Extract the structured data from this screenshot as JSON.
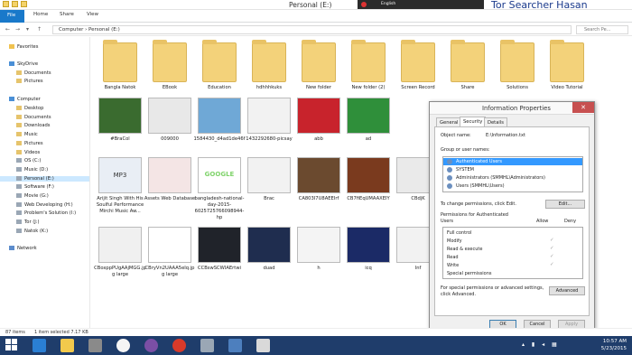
{
  "window": {
    "title": "Personal (E:)",
    "brand_overlay": "Tor Searcher Hasan",
    "recorder_label": "English"
  },
  "ribbon": {
    "tabs": [
      "File",
      "Home",
      "Share",
      "View"
    ]
  },
  "address": {
    "path": "Computer › Personal (E:)",
    "search_placeholder": "Search Pe..."
  },
  "nav": {
    "favorites": "Favorites",
    "skydrive": "SkyDrive",
    "documents": "Documents",
    "pictures": "Pictures",
    "computer": "Computer",
    "items": [
      "Desktop",
      "Documents",
      "Downloads",
      "Music",
      "Pictures",
      "Videos",
      "OS (C:)",
      "Music (D:)",
      "Personal (E:)",
      "Software (F:)",
      "Movie (G:)",
      "Web Developing (H:)",
      "Problem's Solution (I:)",
      "Tor (J:)",
      "Natok (K:)"
    ],
    "network": "Network"
  },
  "files": {
    "row1": [
      "Bangla Natok",
      "EBook",
      "Education",
      "hdhhhkuks",
      "New folder",
      "New folder (2)",
      "Screen Record",
      "Share",
      "Solutions",
      "Video Tutorial"
    ],
    "row2": [
      "#BraCol",
      "009000",
      "1584430_d4ad1de46f",
      "1432292680-picsay",
      "abb",
      "ad",
      "",
      "",
      "",
      ""
    ],
    "row3": [
      "Arijit Singh With His Soulful Performance Mirchi Music Aw...",
      "Assets Web Database",
      "bangladesh-national-day-2015-6025725766098944-hp",
      "Brac",
      "CA803I7U8AEEIrf",
      "CB7fiEqUMAAXEIY",
      "CBdjK",
      "",
      "",
      ""
    ],
    "row4": [
      "CBoxppPUgAAjMGG.jpg large",
      "CBryVn2UAAA5eIq.jpg large",
      "CCBswSCWIAErtwi",
      "duad",
      "h",
      "icq",
      "Inf",
      "",
      "",
      ""
    ],
    "thumb_texts": {
      "google": "GOOGLE",
      "mp3": "MP3"
    }
  },
  "dialog": {
    "title": "Information Properties",
    "tabs": [
      "General",
      "Security",
      "Details"
    ],
    "object_name_label": "Object name:",
    "object_name_value": "E:\\Information.txt",
    "group_label": "Group or user names:",
    "groups": [
      "Authenticated Users",
      "SYSTEM",
      "Administrators (SMMHL\\Administrators)",
      "Users (SMMHL\\Users)"
    ],
    "change_text": "To change permissions, click Edit.",
    "edit_button": "Edit...",
    "permissions_for": "Permissions for Authenticated",
    "permissions_for2": "Users",
    "allow": "Allow",
    "deny": "Deny",
    "permissions": [
      "Full control",
      "Modify",
      "Read & execute",
      "Read",
      "Write",
      "Special permissions"
    ],
    "permission_allowed": [
      false,
      true,
      true,
      true,
      true,
      false
    ],
    "special_text1": "For special permissions or advanced settings,",
    "special_text2": "click Advanced.",
    "advanced_button": "Advanced",
    "ok_button": "OK",
    "cancel_button": "Cancel",
    "apply_button": "Apply"
  },
  "status": {
    "item_count": "87 items",
    "selection": "1 item selected  7.17 KB"
  },
  "taskbar": {
    "time": "10:57 AM",
    "date": "5/23/2015"
  }
}
